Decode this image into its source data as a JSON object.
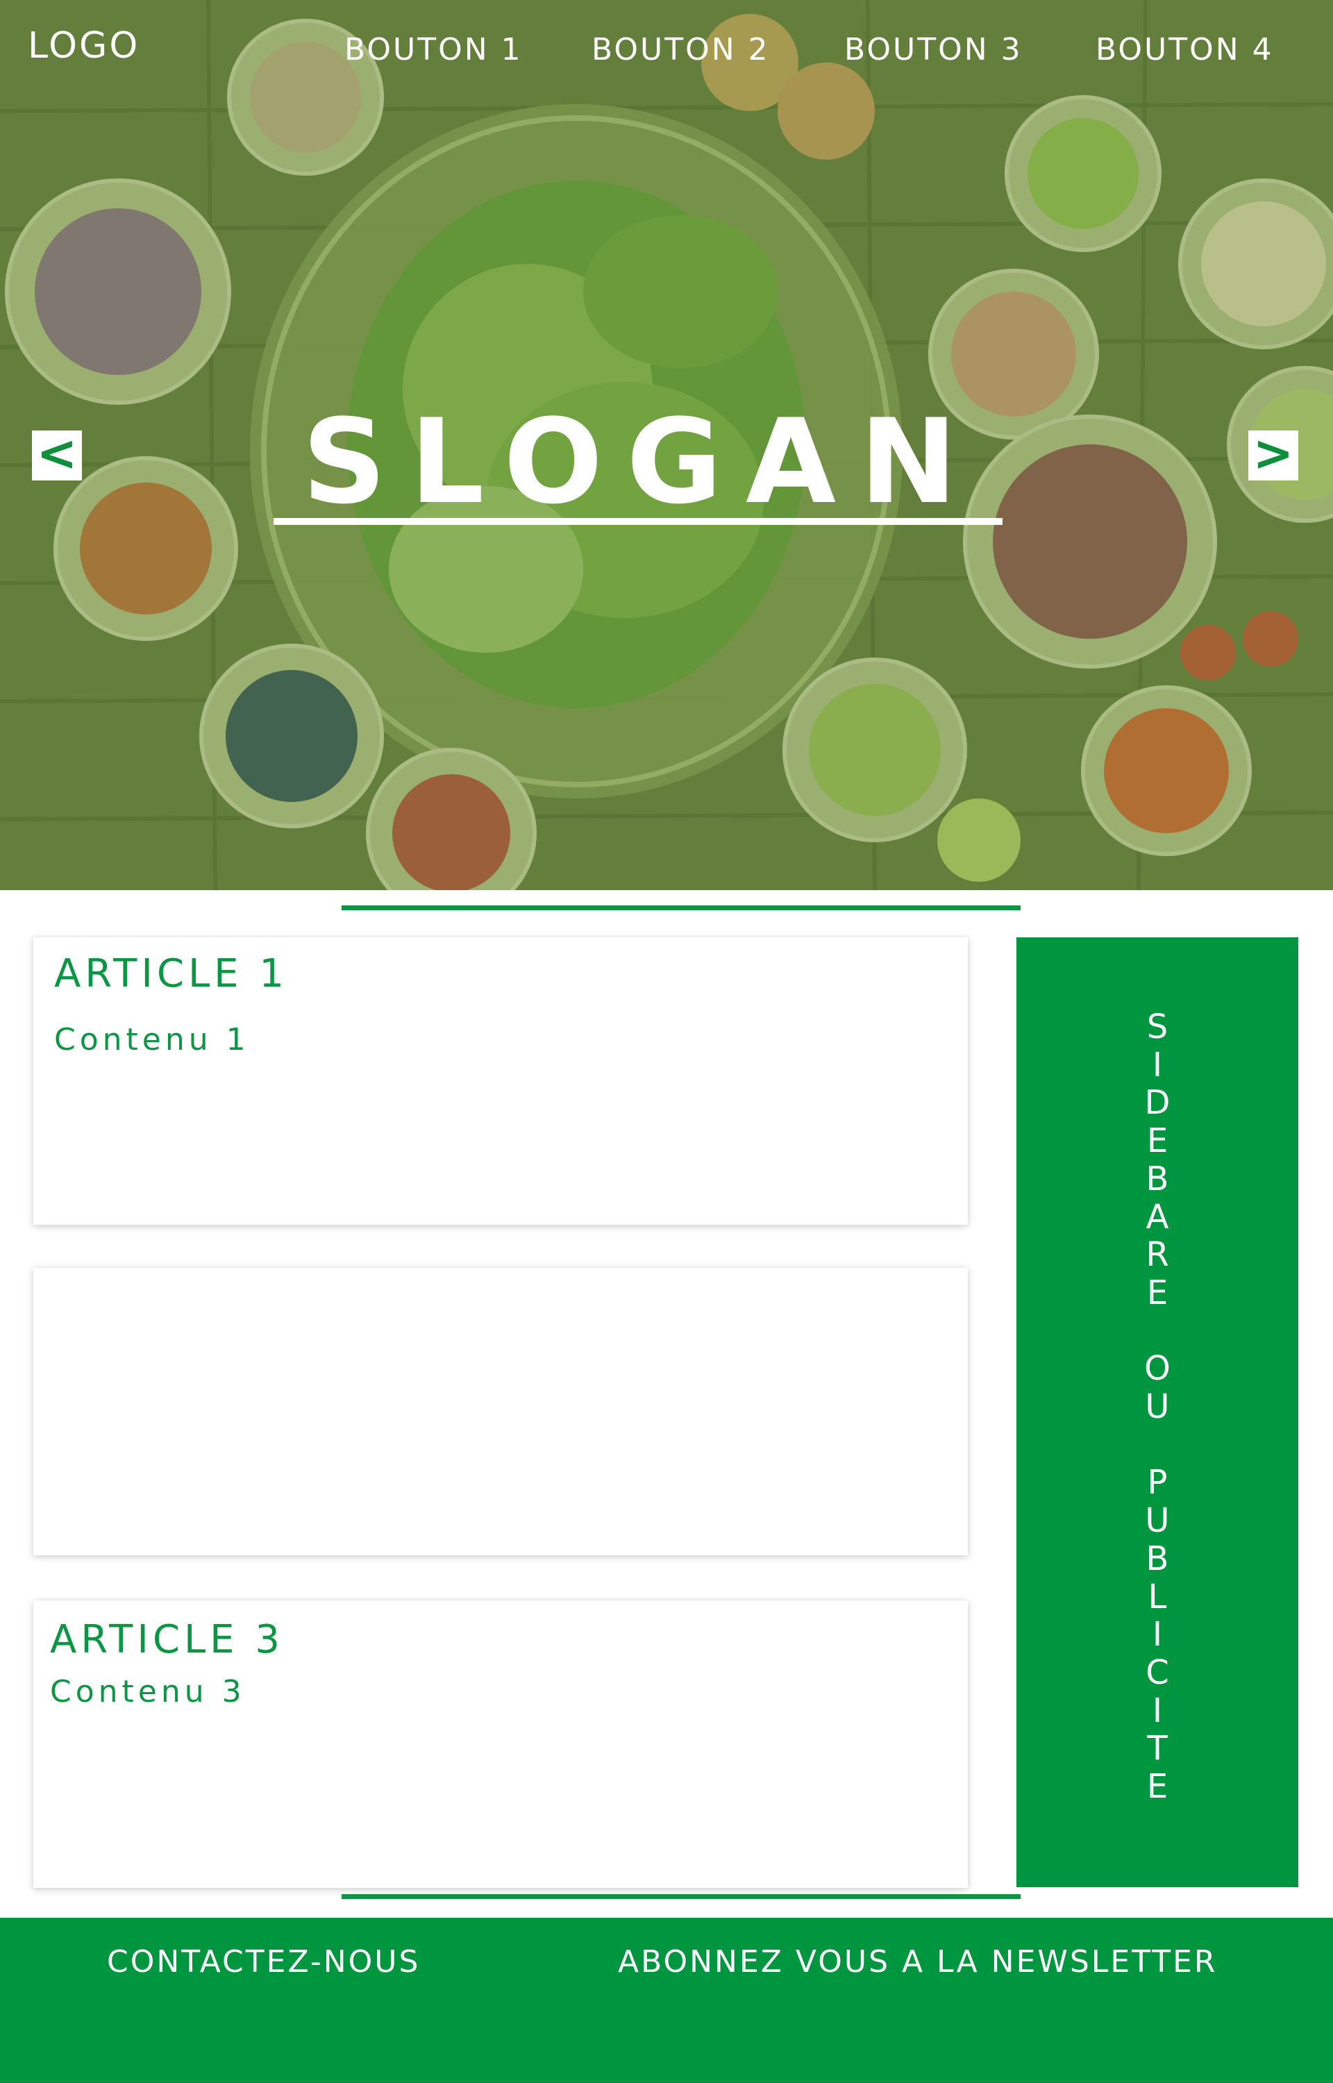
{
  "header": {
    "logo": "LOGO",
    "nav": [
      "BOUTON 1",
      "BOUTON 2",
      "BOUTON 3",
      "BOUTON 4"
    ]
  },
  "hero": {
    "slogan": "SLOGAN",
    "prev_arrow": "<",
    "next_arrow": ">",
    "background": "salad-photo"
  },
  "articles": [
    {
      "title": "ARTICLE 1",
      "content": "Contenu 1"
    },
    {
      "title": "",
      "content": ""
    },
    {
      "title": "ARTICLE 3",
      "content": "Contenu 3"
    }
  ],
  "sidebar": {
    "text": "SIDEBARE OU PUBLICITE"
  },
  "footer": {
    "contact": "CONTACTEZ-NOUS",
    "newsletter": "ABONNEZ VOUS A LA NEWSLETTER"
  },
  "colors": {
    "brand_green": "#009640",
    "hero_tint": "#6a8a3a",
    "white": "#ffffff"
  }
}
